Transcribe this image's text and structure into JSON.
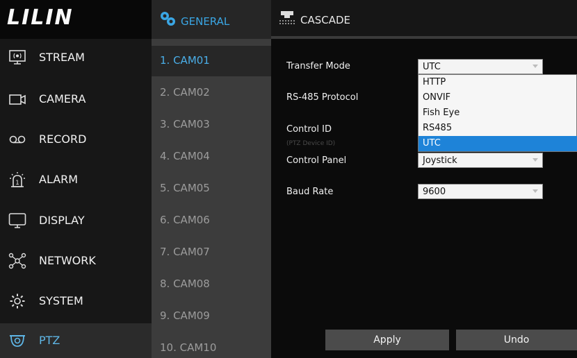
{
  "logo": {
    "text": "LILIN"
  },
  "sidebar": {
    "items": [
      {
        "label": "STREAM",
        "icon": "stream-icon"
      },
      {
        "label": "CAMERA",
        "icon": "camera-icon"
      },
      {
        "label": "RECORD",
        "icon": "record-icon"
      },
      {
        "label": "ALARM",
        "icon": "alarm-icon"
      },
      {
        "label": "DISPLAY",
        "icon": "display-icon"
      },
      {
        "label": "NETWORK",
        "icon": "network-icon"
      },
      {
        "label": "SYSTEM",
        "icon": "gear-icon"
      },
      {
        "label": "PTZ",
        "icon": "ptz-camera-icon",
        "active": true
      }
    ]
  },
  "tabs": {
    "general": "GENERAL",
    "cascade": "CASCADE"
  },
  "cameras": [
    "1. CAM01",
    "2. CAM02",
    "3. CAM03",
    "4. CAM04",
    "5. CAM05",
    "6. CAM06",
    "7. CAM07",
    "8. CAM08",
    "9. CAM09",
    "10. CAM10"
  ],
  "form": {
    "transfer_mode": {
      "label": "Transfer Mode",
      "value": "UTC"
    },
    "rs485_protocol": {
      "label": "RS-485 Protocol"
    },
    "control_id": {
      "label": "Control ID",
      "sublabel": "(PTZ Device ID)"
    },
    "control_panel": {
      "label": "Control Panel",
      "value": "Joystick"
    },
    "baud_rate": {
      "label": "Baud Rate",
      "value": "9600"
    }
  },
  "dropdown": {
    "options": [
      "HTTP",
      "ONVIF",
      "Fish Eye",
      "RS485",
      "UTC"
    ],
    "selected": "UTC"
  },
  "buttons": {
    "apply": "Apply",
    "undo": "Undo"
  },
  "colors": {
    "accent": "#3aa6e4",
    "selected_option": "#1e83d8"
  }
}
